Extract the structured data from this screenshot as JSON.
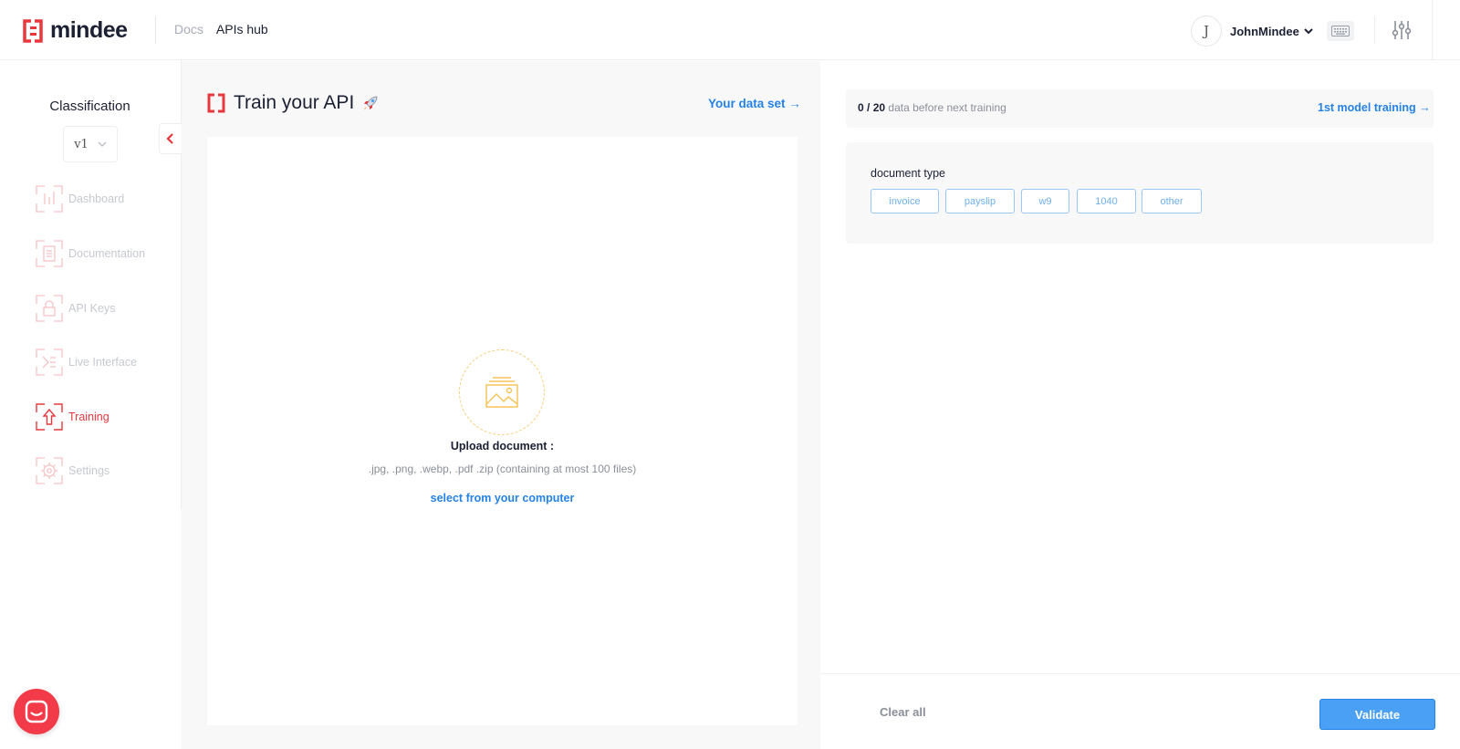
{
  "header": {
    "brand": "mindee",
    "nav": [
      {
        "label": "Docs"
      },
      {
        "label": "APIs hub"
      }
    ],
    "user": {
      "initial": "J",
      "name": "JohnMindee"
    }
  },
  "sidebar": {
    "api_name": "Classification",
    "version": "v1",
    "items": [
      {
        "label": "Dashboard",
        "icon": "dashboard-icon",
        "active": false
      },
      {
        "label": "Documentation",
        "icon": "documentation-icon",
        "active": false
      },
      {
        "label": "API Keys",
        "icon": "lock-icon",
        "active": false
      },
      {
        "label": "Live Interface",
        "icon": "live-interface-icon",
        "active": false
      },
      {
        "label": "Training",
        "icon": "upload-arrow-icon",
        "active": true
      },
      {
        "label": "Settings",
        "icon": "gear-icon",
        "active": false
      }
    ]
  },
  "training": {
    "title": "Train your API",
    "dataset_link": "Your data set →",
    "upload": {
      "title": "Upload document :",
      "formats": ".jpg, .png, .webp, .pdf .zip (containing at most 100 files)",
      "select_label": "select from your computer"
    }
  },
  "right_panel": {
    "progress": {
      "current": "0",
      "total": "20",
      "sep": " / ",
      "suffix": " data before next training"
    },
    "model_link": "1st model training →",
    "doctype_label": "document type",
    "chips": [
      "invoice",
      "payslip",
      "w9",
      "1040",
      "other"
    ],
    "clear_label": "Clear all",
    "validate_label": "Validate"
  },
  "colors": {
    "brand_red": "#e8383d",
    "link_blue": "#2582e6",
    "validate_bg": "#4aa0f5",
    "chat_red": "#f23a48",
    "upload_accent": "#f6c35d"
  }
}
